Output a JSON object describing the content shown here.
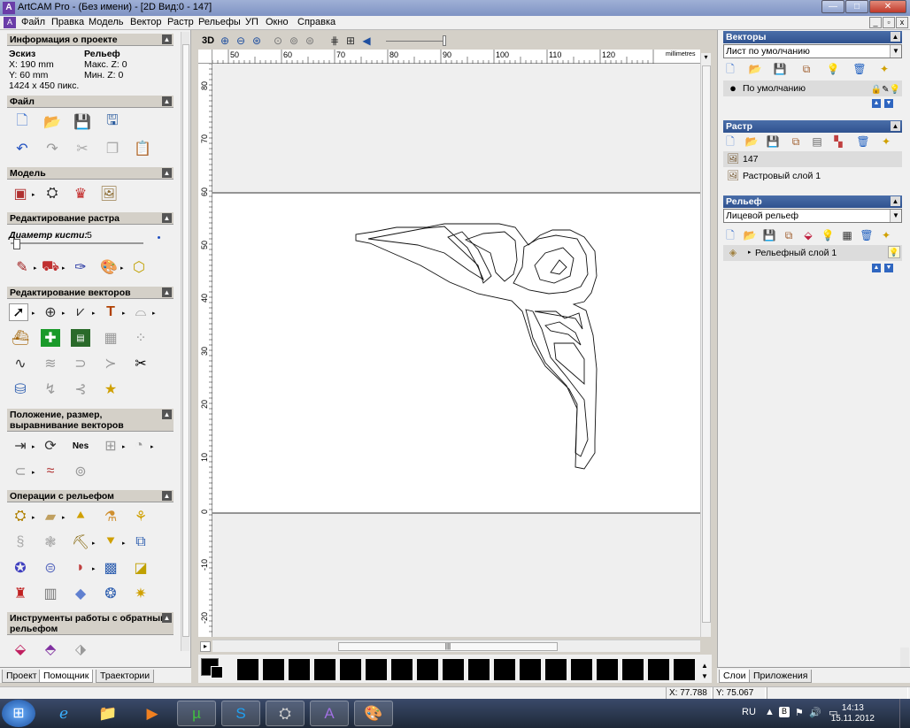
{
  "window": {
    "title": "ArtCAM Pro - (Без имени) - [2D Вид:0 - 147]"
  },
  "menu": [
    "Файл",
    "Правка",
    "Модель",
    "Вектор",
    "Растр",
    "Рельефы",
    "УП",
    "Окно",
    "Справка"
  ],
  "left": {
    "project_info": {
      "title": "Информация о проекте",
      "col1_header": "Эскиз",
      "col2_header": "Рельеф",
      "x": "X: 190 mm",
      "y": "Y: 60 mm",
      "pixels": "1424 x 450 пикс.",
      "max_z": "Макс. Z: 0",
      "min_z": "Мин. Z: 0"
    },
    "sections": {
      "file": "Файл",
      "model": "Модель",
      "raster_edit": "Редактирование растра",
      "vector_edit": "Редактирование векторов",
      "position": "Положение, размер, выравнивание векторов",
      "relief_ops": "Операции с рельефом",
      "reverse_relief": "Инструменты работы с обратным рельефом"
    },
    "brush_label": "Диаметр кисти:",
    "brush_value": "5",
    "tabs": [
      "Проект",
      "Помощник",
      "Траектории"
    ],
    "active_tab": 1
  },
  "view": {
    "toolbar_3d": "3D",
    "units": "millimetres",
    "ruler_x": [
      "50",
      "60",
      "70",
      "80",
      "90",
      "100",
      "110",
      "120"
    ],
    "ruler_y": [
      "80",
      "70",
      "60",
      "50",
      "40",
      "30",
      "20",
      "10",
      "0",
      "-10",
      "-20"
    ]
  },
  "right": {
    "vectors": {
      "title": "Векторы",
      "sheet": "Лист по умолчанию",
      "layer": "По умолчанию"
    },
    "raster": {
      "title": "Растр",
      "items": [
        "147",
        "Растровый слой 1"
      ]
    },
    "relief": {
      "title": "Рельеф",
      "combo": "Лицевой рельеф",
      "layer": "Рельефный слой 1"
    },
    "tabs": [
      "Слои",
      "Приложения"
    ],
    "active_tab": 0
  },
  "status": {
    "x": "X: 77.788",
    "y": "Y: 75.067"
  },
  "taskbar": {
    "lang": "RU",
    "time": "14:13",
    "date": "15.11.2012"
  },
  "colors": {
    "accent": "#2f528f",
    "canvas": "#efefef",
    "sheet": "#ffffff"
  }
}
